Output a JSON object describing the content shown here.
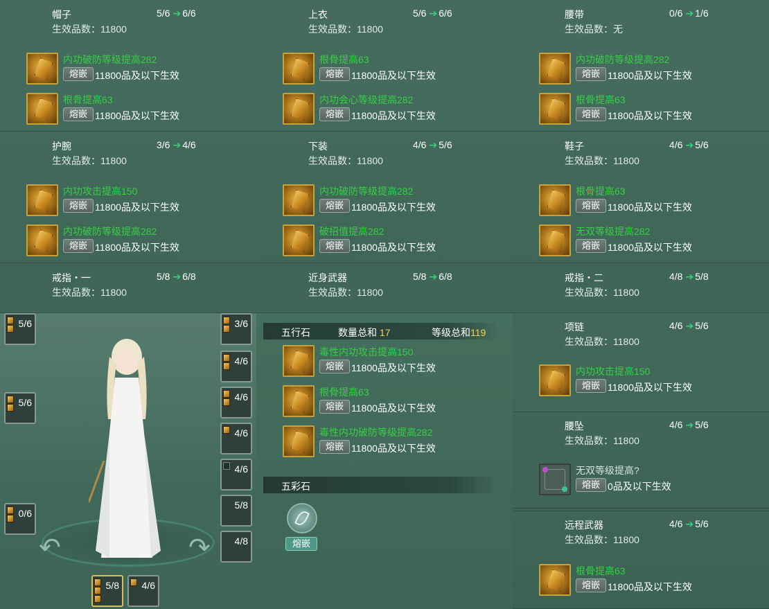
{
  "inlay_label": "熔嵌",
  "slots": [
    {
      "name": "帽子",
      "progress": "5/6",
      "next": "6/6",
      "grade": "生效品数：11800",
      "gems": [
        {
          "name": "内功破防等级提高282",
          "desc": "11800品及以下生效"
        },
        {
          "name": "根骨提高63",
          "desc": "11800品及以下生效"
        }
      ]
    },
    {
      "name": "上衣",
      "progress": "5/6",
      "next": "6/6",
      "grade": "生效品数：11800",
      "gems": [
        {
          "name": "根骨提高63",
          "desc": "11800品及以下生效"
        },
        {
          "name": "内功会心等级提高282",
          "desc": "11800品及以下生效"
        }
      ]
    },
    {
      "name": "腰带",
      "progress": "0/6",
      "next": "1/6",
      "grade": "生效品数：无",
      "gems": [
        {
          "name": "内功破防等级提高282",
          "desc": "11800品及以下生效"
        },
        {
          "name": "根骨提高63",
          "desc": "11800品及以下生效"
        }
      ]
    },
    {
      "name": "护腕",
      "progress": "3/6",
      "next": "4/6",
      "grade": "生效品数：11800",
      "gems": [
        {
          "name": "内功攻击提高150",
          "desc": "11800品及以下生效"
        },
        {
          "name": "内功破防等级提高282",
          "desc": "11800品及以下生效"
        }
      ]
    },
    {
      "name": "下装",
      "progress": "4/6",
      "next": "5/6",
      "grade": "生效品数：11800",
      "gems": [
        {
          "name": "内功破防等级提高282",
          "desc": "11800品及以下生效"
        },
        {
          "name": "破招值提高282",
          "desc": "11800品及以下生效"
        }
      ]
    },
    {
      "name": "鞋子",
      "progress": "4/6",
      "next": "5/6",
      "grade": "生效品数：11800",
      "gems": [
        {
          "name": "根骨提高63",
          "desc": "11800品及以下生效"
        },
        {
          "name": "无双等级提高282",
          "desc": "11800品及以下生效"
        }
      ]
    },
    {
      "name": "戒指・一",
      "progress": "5/8",
      "next": "6/8",
      "grade": "生效品数：11800",
      "gems": []
    },
    {
      "name": "近身武器",
      "progress": "5/8",
      "next": "6/8",
      "grade": "生效品数：11800",
      "gems": []
    },
    {
      "name": "戒指・二",
      "progress": "4/8",
      "next": "5/8",
      "grade": "生效品数：11800",
      "gems": []
    },
    {
      "name": "项链",
      "progress": "4/6",
      "next": "5/6",
      "grade": "生效品数：11800",
      "gems": [
        {
          "name": "内功攻击提高150",
          "desc": "11800品及以下生效"
        }
      ]
    },
    {
      "name": "腰坠",
      "progress": "4/6",
      "next": "5/6",
      "grade": "生效品数：11800",
      "gems": [
        {
          "name": "无双等级提高?",
          "desc": "0品及以下生效"
        }
      ]
    },
    {
      "name": "远程武器",
      "progress": "4/6",
      "next": "5/6",
      "grade": "生效品数：11800",
      "gems": [
        {
          "name": "根骨提高63",
          "desc": "11800品及以下生效"
        }
      ]
    }
  ],
  "five_elements": {
    "title": "五行石",
    "count_label": "数量总和",
    "count": "17",
    "level_label": "等级总和",
    "level": "119",
    "gems": [
      {
        "name": "毒性内功攻击提高150",
        "desc": "11800品及以下生效"
      },
      {
        "name": "根骨提高63",
        "desc": "11800品及以下生效"
      },
      {
        "name": "毒性内功破防等级提高282",
        "desc": "11800品及以下生效"
      }
    ]
  },
  "colored_stone": {
    "title": "五彩石",
    "button": "熔嵌"
  },
  "equip_slots": {
    "left": [
      "5/6",
      "5/6",
      "0/6"
    ],
    "right": [
      "3/6",
      "4/6",
      "4/6",
      "4/6",
      "4/6",
      "5/8",
      "4/8"
    ],
    "bottom": [
      "5/8",
      "4/6"
    ]
  },
  "colors": {
    "gem_name": "#35d043",
    "accent_number": "#f5d24a",
    "arrow": "#34d27a"
  }
}
